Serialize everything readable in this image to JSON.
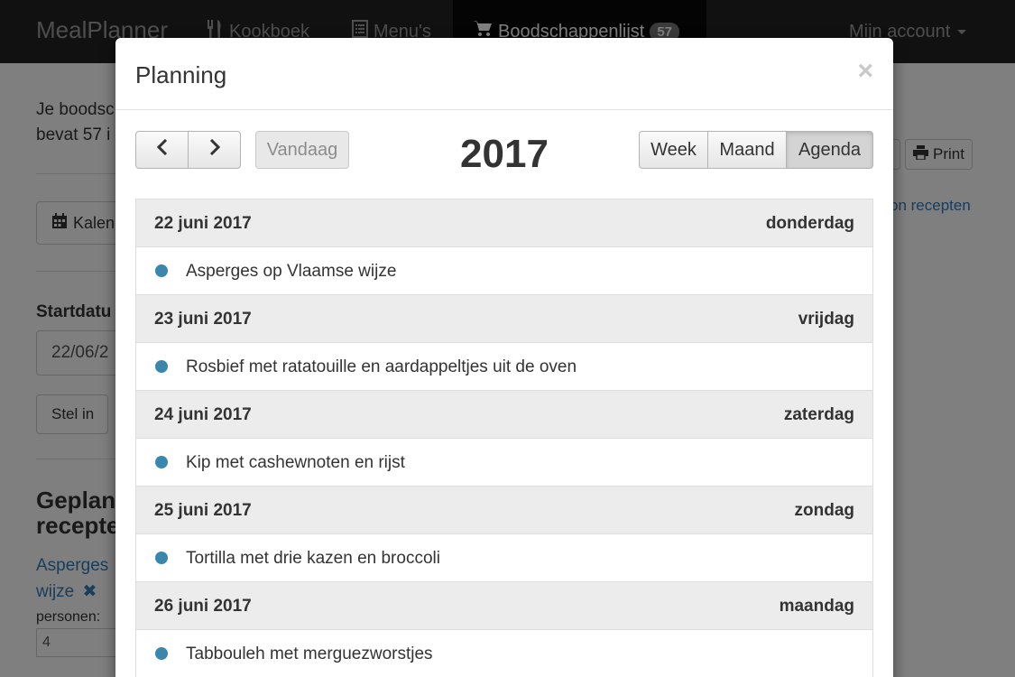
{
  "navbar": {
    "brand": "MealPlanner",
    "items": [
      {
        "label": "Kookboek"
      },
      {
        "label": "Menu's"
      },
      {
        "label": "Boodschappenlijst",
        "badge": "57"
      }
    ],
    "account": "Mijn account"
  },
  "background": {
    "intro_line1": "Je boodsc",
    "intro_line2": "bevat 57 i",
    "calendar_button": "Kalen",
    "print_button": "Print",
    "recipes_link": "on recepten",
    "startdate_label": "Startdatu",
    "startdate_value": "22/06/2",
    "set_button": "Stel in",
    "planned_heading_line1": "Geplan",
    "planned_heading_line2": "recepte",
    "recipe_link_line1": "Asperges",
    "recipe_link_line2": "wijze",
    "persons_label": "personen:",
    "persons_value": "4"
  },
  "modal": {
    "title": "Planning",
    "close_symbol": "×",
    "today_button": "Vandaag",
    "year": "2017",
    "views": [
      "Week",
      "Maand",
      "Agenda"
    ],
    "active_view": "Agenda",
    "event_color": "#3a87ad",
    "days": [
      {
        "date": "22 juni 2017",
        "weekday": "donderdag",
        "event": "Asperges op Vlaamse wijze"
      },
      {
        "date": "23 juni 2017",
        "weekday": "vrijdag",
        "event": "Rosbief met ratatouille en aardappeltjes uit de oven"
      },
      {
        "date": "24 juni 2017",
        "weekday": "zaterdag",
        "event": "Kip met cashewnoten en rijst"
      },
      {
        "date": "25 juni 2017",
        "weekday": "zondag",
        "event": "Tortilla met drie kazen en broccoli"
      },
      {
        "date": "26 juni 2017",
        "weekday": "maandag",
        "event": "Tabbouleh met merguezworstjes"
      }
    ]
  }
}
